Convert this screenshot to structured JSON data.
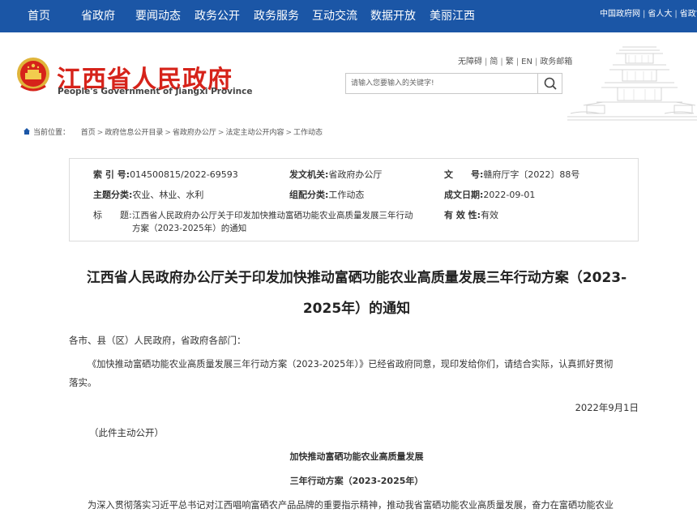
{
  "nav": {
    "items": [
      "首页",
      "省政府",
      "要闻动态",
      "政务公开",
      "政务服务",
      "互动交流",
      "数据开放",
      "美丽江西"
    ],
    "right_links": [
      "中国政府网",
      "省人大",
      "省政协"
    ]
  },
  "header": {
    "site_name": "江西省人民政府",
    "site_name_en": "People's Government of Jiangxi Province",
    "utility": [
      "无障碍",
      "简",
      "繁",
      "EN",
      "政务邮箱"
    ],
    "search_placeholder": "请输入您要输入的关键字!"
  },
  "breadcrumb": {
    "prefix": "当前位置：",
    "items": [
      "首页",
      "政府信息公开目录",
      "省政府办公厅",
      "法定主动公开内容",
      "工作动态"
    ]
  },
  "info": {
    "index_label": "索 引 号:",
    "index_value": "014500815/2022-69593",
    "issuer_label": "发文机关:",
    "issuer_value": "省政府办公厅",
    "docno_label": "文　　号:",
    "docno_value": "赣府厅字〔2022〕88号",
    "theme_label": "主题分类:",
    "theme_value": "农业、林业、水利",
    "category_label": "组配分类:",
    "category_value": "工作动态",
    "date_label": "成文日期:",
    "date_value": "2022-09-01",
    "title_label": "标　　题:",
    "title_value_line1": "江西省人民政府办公厅关于印发加快推动富硒功能农业高质量发展三年行动",
    "title_value_line2": "方案（2023-2025年）的通知",
    "validity_label": "有 效 性:",
    "validity_value": "有效"
  },
  "article": {
    "title_line1": "江西省人民政府办公厅关于印发加快推动富硒功能农业高质量发展三年行动方案（2023-",
    "title_line2": "2025年）的通知",
    "salutation": "各市、县（区）人民政府，省政府各部门：",
    "body_line1": "《加快推动富硒功能农业高质量发展三年行动方案（2023-2025年）》已经省政府同意，现印发给你们，请结合实际，认真抓好贯彻",
    "body_line2": "落实。",
    "date": "2022年9月1日",
    "public_note": "（此件主动公开）",
    "sub_title1": "加快推动富硒功能农业高质量发展",
    "sub_title2": "三年行动方案（2023-2025年）",
    "intro": "为深入贯彻落实习近平总书记对江西唱响富硒农产品品牌的重要指示精神，推动我省富硒功能农业高质量发展，奋力在富硒功能农业"
  },
  "colors": {
    "nav_bg": "#1b56a6",
    "brand_red": "#d6231a"
  }
}
